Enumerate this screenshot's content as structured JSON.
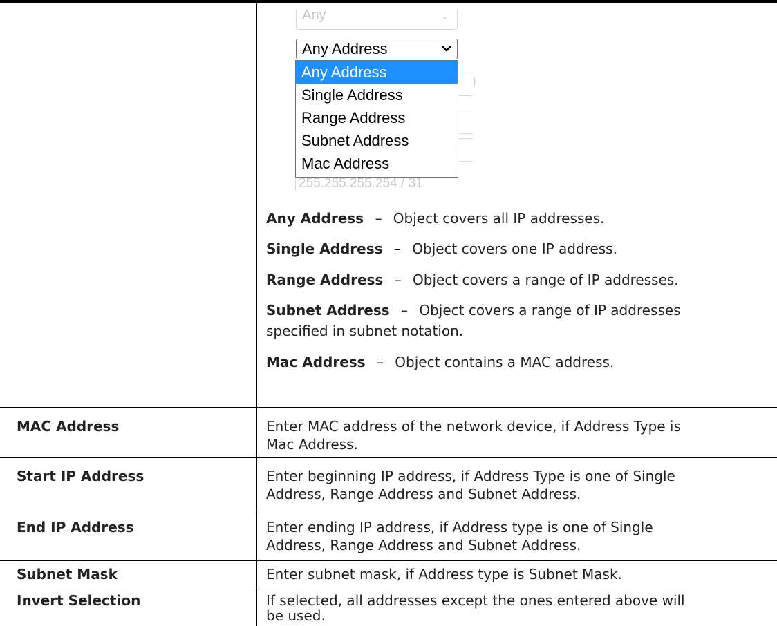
{
  "dropdown": {
    "ghost_above_value": "Any",
    "selected_value": "Any Address",
    "options": [
      "Any Address",
      "Single Address",
      "Range Address",
      "Subnet Address",
      "Mac Address"
    ],
    "ghost_right_fragment": "0",
    "ghost_bottom_value": "255.255.255.254 / 31"
  },
  "address_type_descriptions": [
    {
      "term": "Any Address",
      "sep": "–",
      "text": "Object covers all IP addresses."
    },
    {
      "term": "Single Address",
      "sep": "–",
      "text": "Object covers one IP address."
    },
    {
      "term": "Range Address",
      "sep": "–",
      "text": "Object covers a range of IP addresses."
    },
    {
      "term": "Subnet Address",
      "sep": "–",
      "text": "Object covers a range of IP addresses",
      "text2": "specified in subnet notation."
    },
    {
      "term": "Mac Address",
      "sep": "–",
      "text": "Object contains a MAC address."
    }
  ],
  "rows": [
    {
      "label": "MAC Address",
      "desc1": "Enter MAC address of the network device, if Address Type is",
      "desc2": "Mac Address."
    },
    {
      "label": "Start IP Address",
      "desc1": "Enter beginning IP address, if Address Type is one of Single",
      "desc2": "Address, Range Address and Subnet Address."
    },
    {
      "label": "End IP Address",
      "desc1": "Enter ending IP address, if Address type is one of Single",
      "desc2": "Address, Range Address and Subnet Address."
    },
    {
      "label": "Subnet Mask",
      "desc1": "Enter subnet mask, if Address type is Subnet Mask.",
      "desc2": ""
    },
    {
      "label": "Invert Selection",
      "desc1": "If selected, all addresses except the ones entered above will",
      "desc2": "be used."
    }
  ]
}
